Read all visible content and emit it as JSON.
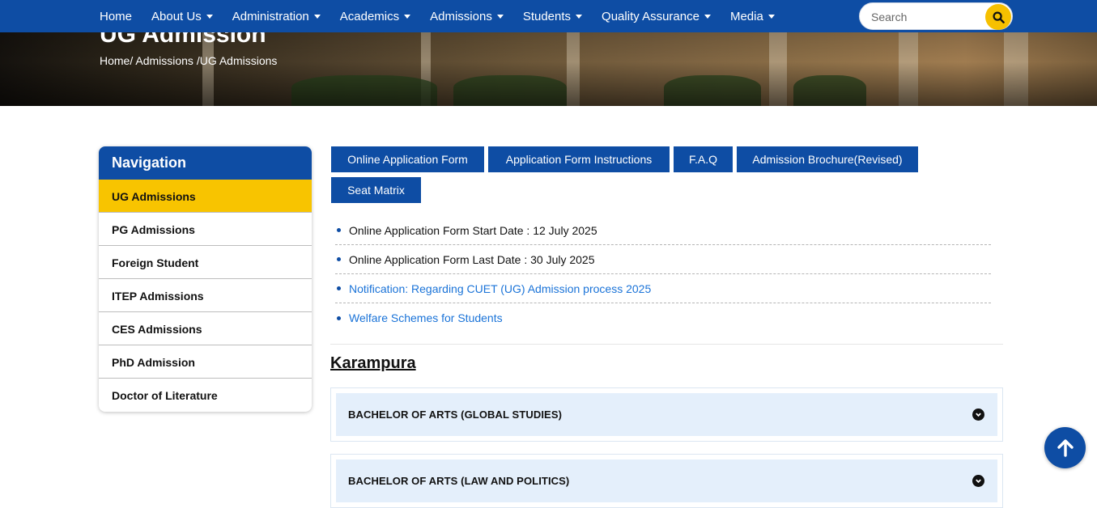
{
  "nav": {
    "items": [
      {
        "label": "Home",
        "dropdown": false
      },
      {
        "label": "About Us",
        "dropdown": true
      },
      {
        "label": "Administration",
        "dropdown": true
      },
      {
        "label": "Academics",
        "dropdown": true
      },
      {
        "label": "Admissions",
        "dropdown": true
      },
      {
        "label": "Students",
        "dropdown": true
      },
      {
        "label": "Quality Assurance",
        "dropdown": true
      },
      {
        "label": "Media",
        "dropdown": true
      }
    ],
    "search_placeholder": "Search",
    "search_icon": "search-icon"
  },
  "banner": {
    "title": "UG Admission",
    "breadcrumb": [
      "Home/",
      " Admissions /",
      "UG Admissions"
    ]
  },
  "sidebar": {
    "heading": "Navigation",
    "items": [
      {
        "label": "UG Admissions",
        "active": true
      },
      {
        "label": "PG Admissions",
        "active": false
      },
      {
        "label": "Foreign Student",
        "active": false
      },
      {
        "label": "ITEP Admissions",
        "active": false
      },
      {
        "label": "CES Admissions",
        "active": false
      },
      {
        "label": "PhD Admission",
        "active": false
      },
      {
        "label": "Doctor of Literature",
        "active": false
      }
    ]
  },
  "tabs": [
    {
      "label": "Online Application Form"
    },
    {
      "label": "Application Form Instructions"
    },
    {
      "label": "F.A.Q"
    },
    {
      "label": "Admission Brochure(Revised)"
    },
    {
      "label": "Seat Matrix"
    }
  ],
  "info": [
    {
      "text": "Online Application Form Start Date : 12 July 2025",
      "link": false
    },
    {
      "text": "Online Application Form Last Date : 30 July 2025",
      "link": false
    },
    {
      "text": "Notification: Regarding CUET (UG) Admission process 2025",
      "link": true
    },
    {
      "text": "Welfare Schemes for Students",
      "link": true
    }
  ],
  "campus": "Karampura",
  "courses": [
    {
      "title": "BACHELOR OF ARTS (GLOBAL STUDIES)"
    },
    {
      "title": "BACHELOR OF ARTS (LAW AND POLITICS)"
    }
  ],
  "colors": {
    "primary": "#0e4da4",
    "accent": "#f8c400",
    "link": "#1a73d8",
    "accordion_bg": "#e4effb"
  }
}
